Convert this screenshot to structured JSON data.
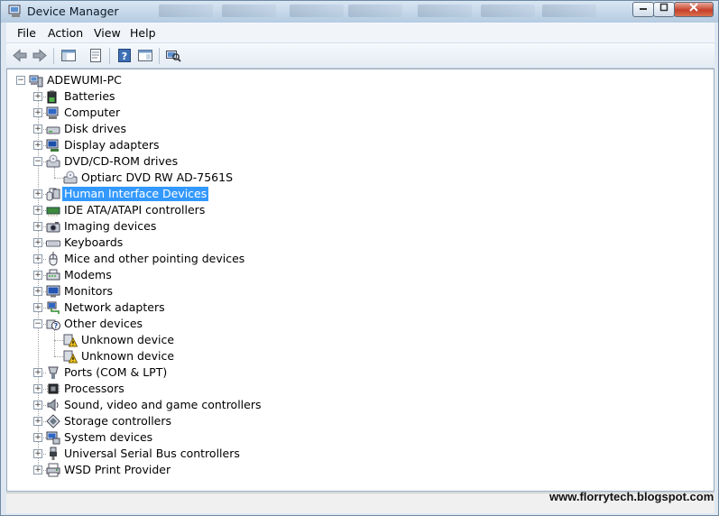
{
  "window": {
    "title": "Device Manager"
  },
  "menu": [
    "File",
    "Action",
    "View",
    "Help"
  ],
  "toolbar": [
    "back-icon",
    "forward-icon",
    "show-hide-console-tree-icon",
    "properties-icon",
    "help-icon",
    "update-driver-icon",
    "scan-hardware-icon"
  ],
  "tree": {
    "root": "ADEWUMI-PC",
    "items": [
      {
        "label": "Batteries",
        "icon": "battery-icon",
        "expanded": false,
        "children": []
      },
      {
        "label": "Computer",
        "icon": "computer-icon",
        "expanded": false,
        "children": []
      },
      {
        "label": "Disk drives",
        "icon": "disk-drive-icon",
        "expanded": false,
        "children": []
      },
      {
        "label": "Display adapters",
        "icon": "display-adapter-icon",
        "expanded": false,
        "children": []
      },
      {
        "label": "DVD/CD-ROM drives",
        "icon": "dvd-drive-icon",
        "expanded": true,
        "children": [
          {
            "label": "Optiarc DVD RW AD-7561S",
            "icon": "dvd-drive-icon"
          }
        ]
      },
      {
        "label": "Human Interface Devices",
        "icon": "hid-icon",
        "expanded": false,
        "selected": true,
        "children": []
      },
      {
        "label": "IDE ATA/ATAPI controllers",
        "icon": "ide-controller-icon",
        "expanded": false,
        "children": []
      },
      {
        "label": "Imaging devices",
        "icon": "imaging-icon",
        "expanded": false,
        "children": []
      },
      {
        "label": "Keyboards",
        "icon": "keyboard-icon",
        "expanded": false,
        "children": []
      },
      {
        "label": "Mice and other pointing devices",
        "icon": "mouse-icon",
        "expanded": false,
        "children": []
      },
      {
        "label": "Modems",
        "icon": "modem-icon",
        "expanded": false,
        "children": []
      },
      {
        "label": "Monitors",
        "icon": "monitor-icon",
        "expanded": false,
        "children": []
      },
      {
        "label": "Network adapters",
        "icon": "network-icon",
        "expanded": false,
        "children": []
      },
      {
        "label": "Other devices",
        "icon": "other-devices-icon",
        "expanded": true,
        "children": [
          {
            "label": "Unknown device",
            "icon": "warning-device-icon"
          },
          {
            "label": "Unknown device",
            "icon": "warning-device-icon"
          }
        ]
      },
      {
        "label": "Ports (COM & LPT)",
        "icon": "port-icon",
        "expanded": false,
        "children": []
      },
      {
        "label": "Processors",
        "icon": "processor-icon",
        "expanded": false,
        "children": []
      },
      {
        "label": "Sound, video and game controllers",
        "icon": "sound-icon",
        "expanded": false,
        "children": []
      },
      {
        "label": "Storage controllers",
        "icon": "storage-icon",
        "expanded": false,
        "children": []
      },
      {
        "label": "System devices",
        "icon": "system-devices-icon",
        "expanded": false,
        "children": []
      },
      {
        "label": "Universal Serial Bus controllers",
        "icon": "usb-icon",
        "expanded": false,
        "children": []
      },
      {
        "label": "WSD Print Provider",
        "icon": "printer-icon",
        "expanded": false,
        "children": []
      }
    ]
  },
  "watermark": "www.florrytech.blogspot.com",
  "colors": {
    "selection": "#3399ff",
    "titlebar": "#c3d5e8",
    "close": "#c7402a"
  }
}
